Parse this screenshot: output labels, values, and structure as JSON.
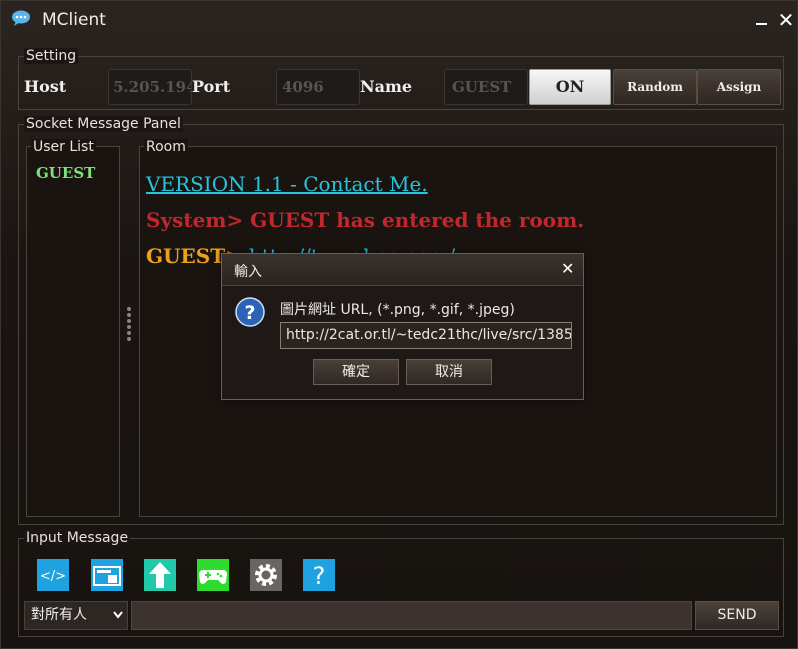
{
  "window": {
    "title": "MClient",
    "icon": "chat-bubble-icon"
  },
  "setting": {
    "legend": "Setting",
    "host_label": "Host",
    "host_value": "5.205.194",
    "port_label": "Port",
    "port_value": "4096",
    "name_label": "Name",
    "name_value": "GUEST",
    "on_label": "ON",
    "random_label": "Random",
    "assign_label": "Assign"
  },
  "socket_panel": {
    "legend": "Socket Message Panel",
    "user_list": {
      "legend": "User List",
      "users": [
        "GUEST"
      ]
    },
    "room": {
      "legend": "Room",
      "version_link": "VERSION 1.1 - Contact Me.",
      "system_message": "System> GUEST has entered the room.",
      "guest_name": "GUEST",
      "guest_separator": "> ",
      "guest_link_partial": "http://tw.yahoo.com/"
    }
  },
  "input_message": {
    "legend": "Input Message",
    "toolbar": [
      "code-icon",
      "picture-icon",
      "upload-arrow-icon",
      "gamepad-icon",
      "gear-icon",
      "help-icon"
    ],
    "recipient_selected": "對所有人",
    "send_label": "SEND"
  },
  "dialog": {
    "title": "輸入",
    "prompt": "圖片網址 URL, (*.png, *.gif, *.jpeg)",
    "url_value": "http://2cat.or.tl/~tedc21thc/live/src/1385",
    "ok_label": "確定",
    "cancel_label": "取消"
  },
  "colors": {
    "user_name": "#7de07b",
    "link": "#28c4de",
    "system": "#c1282e",
    "guest": "#e8a21f"
  }
}
